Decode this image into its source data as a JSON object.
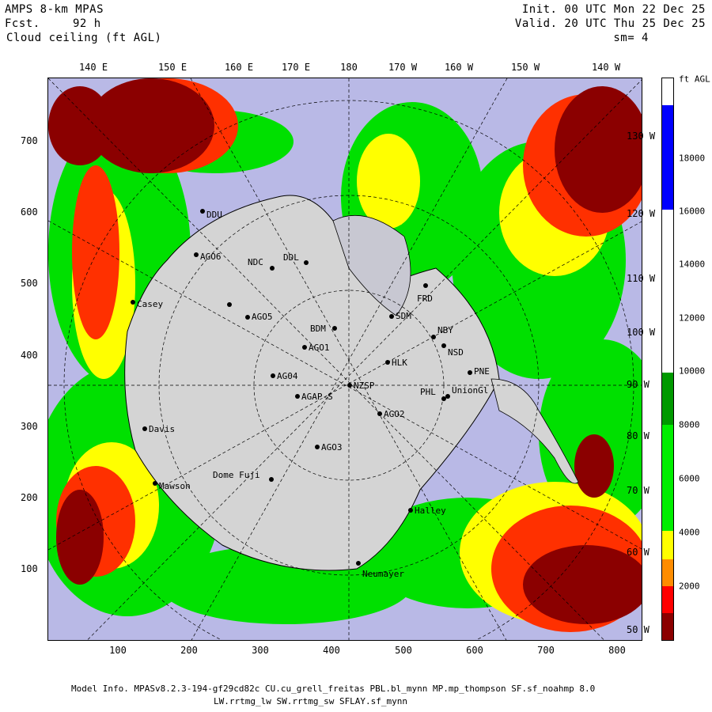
{
  "header": {
    "model": "AMPS 8-km MPAS",
    "forecast_label": "Fcst.",
    "forecast_value": "92 h",
    "field": "Cloud ceiling (ft AGL)",
    "init": "Init. 00 UTC Mon 22 Dec 25",
    "valid": "Valid. 20 UTC Thu 25 Dec 25",
    "smoothing": "sm= 4"
  },
  "top_longitudes": [
    "140 E",
    "150 E",
    "160 E",
    "170 E",
    "180",
    "170 W",
    "160 W",
    "150 W",
    "140 W"
  ],
  "right_longitudes": [
    "130 W",
    "120 W",
    "110 W",
    "100 W",
    "90 W",
    "80 W",
    "70 W",
    "60 W",
    "50 W"
  ],
  "y_ticks": [
    "700",
    "600",
    "500",
    "400",
    "300",
    "200",
    "100"
  ],
  "x_ticks": [
    "100",
    "200",
    "300",
    "400",
    "500",
    "600",
    "700",
    "800"
  ],
  "colorbar": {
    "unit": "ft AGL",
    "labels": [
      "18000",
      "16000",
      "14000",
      "12000",
      "10000",
      "8000",
      "6000",
      "4000",
      "2000"
    ],
    "colors": {
      "lt_2000": "#8b0000",
      "lt_4000": "#ff0000",
      "lt_5000": "#ff8c00",
      "lt_6000": "#ffff00",
      "lt_8000": "#00ee00",
      "lt_10000": "#009900",
      "lt_12000": "#ffffff",
      "gt_16000": "#0000ff"
    }
  },
  "stations": [
    {
      "name": "DDU"
    },
    {
      "name": "AGO6"
    },
    {
      "name": "NDC"
    },
    {
      "name": "DDL"
    },
    {
      "name": "Casey"
    },
    {
      "name": "AGO5"
    },
    {
      "name": "BDM"
    },
    {
      "name": "AGO1"
    },
    {
      "name": "AG04"
    },
    {
      "name": "NZSP"
    },
    {
      "name": "AGAP-S"
    },
    {
      "name": "AGO2"
    },
    {
      "name": "AGO3"
    },
    {
      "name": "Dome Fuji"
    },
    {
      "name": "Mawson"
    },
    {
      "name": "Davis"
    },
    {
      "name": "HLK"
    },
    {
      "name": "FRD"
    },
    {
      "name": "SDM"
    },
    {
      "name": "NBY"
    },
    {
      "name": "NSD"
    },
    {
      "name": "PNE"
    },
    {
      "name": "PHL"
    },
    {
      "name": "UnionGl"
    },
    {
      "name": "Halley"
    },
    {
      "name": "Neumayer"
    }
  ],
  "footer": {
    "line1": "Model Info. MPASv8.2.3-194-gf29cd82c CU.cu_grell_freitas PBL.bl_mynn MP.mp_thompson SF.sf_noahmp 8.0",
    "line2": "LW.rrtmg_lw SW.rrtmg_sw SFLAY.sf_mynn"
  }
}
